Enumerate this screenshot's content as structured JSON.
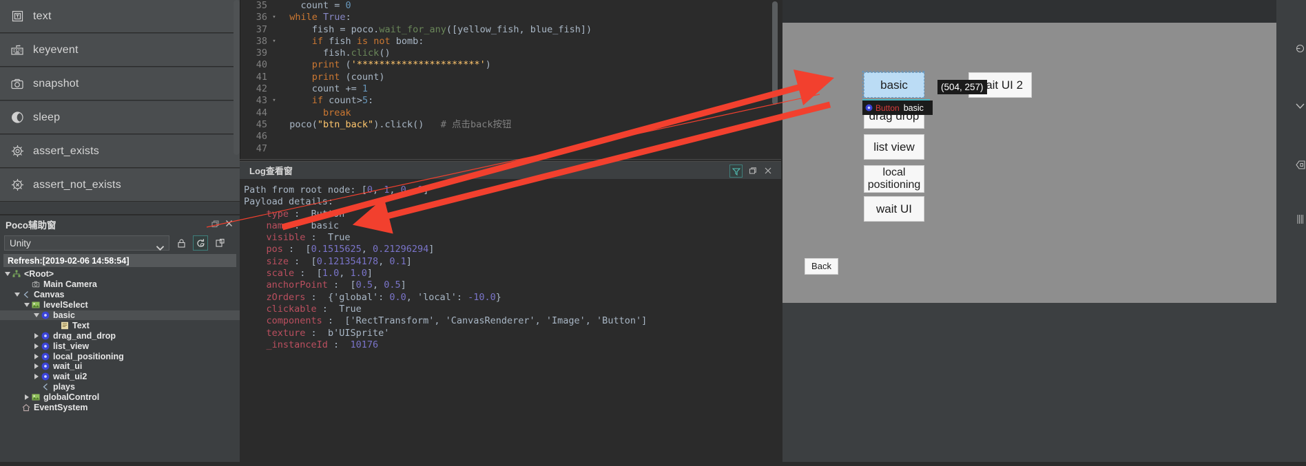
{
  "actions": {
    "items": [
      {
        "label": "text",
        "icon": "text-icon"
      },
      {
        "label": "keyevent",
        "icon": "keyboard-icon"
      },
      {
        "label": "snapshot",
        "icon": "camera-icon"
      },
      {
        "label": "sleep",
        "icon": "moon-icon"
      },
      {
        "label": "assert_exists",
        "icon": "target-icon"
      },
      {
        "label": "assert_not_exists",
        "icon": "target-cross-icon"
      }
    ]
  },
  "editor": {
    "lines": [
      {
        "no": "35",
        "fold": "",
        "tokens": [
          {
            "t": "    ",
            "c": "code"
          },
          {
            "t": "count",
            "c": "code"
          },
          {
            "t": " = ",
            "c": "code"
          },
          {
            "t": "0",
            "c": "num"
          }
        ]
      },
      {
        "no": "36",
        "fold": "▾",
        "tokens": [
          {
            "t": "  ",
            "c": "code"
          },
          {
            "t": "while",
            "c": "kw"
          },
          {
            "t": " ",
            "c": "code"
          },
          {
            "t": "True",
            "c": "bi"
          },
          {
            "t": ":",
            "c": "code"
          }
        ]
      },
      {
        "no": "37",
        "fold": "",
        "tokens": [
          {
            "t": "      fish = poco.",
            "c": "code"
          },
          {
            "t": "wait_for_any",
            "c": "str"
          },
          {
            "t": "([yellow_fish, blue_fish])",
            "c": "code"
          }
        ]
      },
      {
        "no": "38",
        "fold": "▾",
        "tokens": [
          {
            "t": "      ",
            "c": "code"
          },
          {
            "t": "if",
            "c": "kw"
          },
          {
            "t": " fish ",
            "c": "code"
          },
          {
            "t": "is",
            "c": "kw"
          },
          {
            "t": " ",
            "c": "code"
          },
          {
            "t": "not",
            "c": "kw"
          },
          {
            "t": " bomb:",
            "c": "code"
          }
        ]
      },
      {
        "no": "39",
        "fold": "",
        "tokens": [
          {
            "t": "        fish.",
            "c": "code"
          },
          {
            "t": "click",
            "c": "str"
          },
          {
            "t": "()",
            "c": "code"
          }
        ]
      },
      {
        "no": "40",
        "fold": "",
        "tokens": [
          {
            "t": "      ",
            "c": "code"
          },
          {
            "t": "print",
            "c": "kw"
          },
          {
            "t": " (",
            "c": "code"
          },
          {
            "t": "'**********************'",
            "c": "fn"
          },
          {
            "t": ")",
            "c": "code"
          }
        ]
      },
      {
        "no": "41",
        "fold": "",
        "tokens": [
          {
            "t": "      ",
            "c": "code"
          },
          {
            "t": "print",
            "c": "kw"
          },
          {
            "t": " (count)",
            "c": "code"
          }
        ]
      },
      {
        "no": "42",
        "fold": "",
        "tokens": [
          {
            "t": "      count += ",
            "c": "code"
          },
          {
            "t": "1",
            "c": "num"
          }
        ]
      },
      {
        "no": "43",
        "fold": "▾",
        "tokens": [
          {
            "t": "      ",
            "c": "code"
          },
          {
            "t": "if",
            "c": "kw"
          },
          {
            "t": " count>",
            "c": "code"
          },
          {
            "t": "5",
            "c": "num"
          },
          {
            "t": ":",
            "c": "code"
          }
        ]
      },
      {
        "no": "44",
        "fold": "",
        "tokens": [
          {
            "t": "        ",
            "c": "code"
          },
          {
            "t": "break",
            "c": "kw"
          }
        ]
      },
      {
        "no": "45",
        "fold": "",
        "tokens": [
          {
            "t": "  poco(",
            "c": "code"
          },
          {
            "t": "\"btn_back\"",
            "c": "fn"
          },
          {
            "t": ").",
            "c": "code"
          },
          {
            "t": "click",
            "c": "code"
          },
          {
            "t": "()   ",
            "c": "code"
          },
          {
            "t": "# 点击back按钮",
            "c": "cmt"
          }
        ]
      },
      {
        "no": "46",
        "fold": "",
        "tokens": []
      },
      {
        "no": "47",
        "fold": "",
        "tokens": []
      }
    ]
  },
  "log": {
    "title": "Log查看窗",
    "filter_icon": "filter-icon",
    "restore_icon": "restore-icon",
    "close_icon": "close-icon",
    "lines": [
      [
        {
          "t": "Path from root node: ",
          "c": "lval"
        },
        {
          "t": "[",
          "c": "lpunct"
        },
        {
          "t": "0",
          "c": "lnum"
        },
        {
          "t": ", ",
          "c": "lpunct"
        },
        {
          "t": "1",
          "c": "lnum"
        },
        {
          "t": ", ",
          "c": "lpunct"
        },
        {
          "t": "0",
          "c": "lnum"
        },
        {
          "t": ", ",
          "c": "lpunct"
        },
        {
          "t": "0",
          "c": "lnum"
        },
        {
          "t": "]",
          "c": "lpunct"
        }
      ],
      [
        {
          "t": "Payload details:",
          "c": "lval"
        }
      ],
      [
        {
          "t": "    ",
          "c": "lval"
        },
        {
          "t": "type",
          "c": "lkey"
        },
        {
          "t": " :  ",
          "c": "lval"
        },
        {
          "t": "Button",
          "c": "lval"
        }
      ],
      [
        {
          "t": "    ",
          "c": "lval"
        },
        {
          "t": "name",
          "c": "lkey"
        },
        {
          "t": " :  ",
          "c": "lval"
        },
        {
          "t": "basic",
          "c": "lval"
        }
      ],
      [
        {
          "t": "    ",
          "c": "lval"
        },
        {
          "t": "visible",
          "c": "lkey"
        },
        {
          "t": " :  ",
          "c": "lval"
        },
        {
          "t": "True",
          "c": "lval"
        }
      ],
      [
        {
          "t": "    ",
          "c": "lval"
        },
        {
          "t": "pos",
          "c": "lkey"
        },
        {
          "t": " :  ",
          "c": "lval"
        },
        {
          "t": "[",
          "c": "lpunct"
        },
        {
          "t": "0.1515625",
          "c": "lnum"
        },
        {
          "t": ", ",
          "c": "lpunct"
        },
        {
          "t": "0.21296294",
          "c": "lnum"
        },
        {
          "t": "]",
          "c": "lpunct"
        }
      ],
      [
        {
          "t": "    ",
          "c": "lval"
        },
        {
          "t": "size",
          "c": "lkey"
        },
        {
          "t": " :  ",
          "c": "lval"
        },
        {
          "t": "[",
          "c": "lpunct"
        },
        {
          "t": "0.121354178",
          "c": "lnum"
        },
        {
          "t": ", ",
          "c": "lpunct"
        },
        {
          "t": "0.1",
          "c": "lnum"
        },
        {
          "t": "]",
          "c": "lpunct"
        }
      ],
      [
        {
          "t": "    ",
          "c": "lval"
        },
        {
          "t": "scale",
          "c": "lkey"
        },
        {
          "t": " :  ",
          "c": "lval"
        },
        {
          "t": "[",
          "c": "lpunct"
        },
        {
          "t": "1.0",
          "c": "lnum"
        },
        {
          "t": ", ",
          "c": "lpunct"
        },
        {
          "t": "1.0",
          "c": "lnum"
        },
        {
          "t": "]",
          "c": "lpunct"
        }
      ],
      [
        {
          "t": "    ",
          "c": "lval"
        },
        {
          "t": "anchorPoint",
          "c": "lkey"
        },
        {
          "t": " :  ",
          "c": "lval"
        },
        {
          "t": "[",
          "c": "lpunct"
        },
        {
          "t": "0.5",
          "c": "lnum"
        },
        {
          "t": ", ",
          "c": "lpunct"
        },
        {
          "t": "0.5",
          "c": "lnum"
        },
        {
          "t": "]",
          "c": "lpunct"
        }
      ],
      [
        {
          "t": "    ",
          "c": "lval"
        },
        {
          "t": "zOrders",
          "c": "lkey"
        },
        {
          "t": " :  ",
          "c": "lval"
        },
        {
          "t": "{'global': ",
          "c": "lpunct"
        },
        {
          "t": "0.0",
          "c": "lnum"
        },
        {
          "t": ", 'local': ",
          "c": "lpunct"
        },
        {
          "t": "-10.0",
          "c": "lnum"
        },
        {
          "t": "}",
          "c": "lpunct"
        }
      ],
      [
        {
          "t": "    ",
          "c": "lval"
        },
        {
          "t": "clickable",
          "c": "lkey"
        },
        {
          "t": " :  ",
          "c": "lval"
        },
        {
          "t": "True",
          "c": "lval"
        }
      ],
      [
        {
          "t": "    ",
          "c": "lval"
        },
        {
          "t": "components",
          "c": "lkey"
        },
        {
          "t": " :  ",
          "c": "lval"
        },
        {
          "t": "['RectTransform', 'CanvasRenderer', 'Image', 'Button']",
          "c": "lval"
        }
      ],
      [
        {
          "t": "    ",
          "c": "lval"
        },
        {
          "t": "texture",
          "c": "lkey"
        },
        {
          "t": " :  ",
          "c": "lval"
        },
        {
          "t": "b'UISprite'",
          "c": "lval"
        }
      ],
      [
        {
          "t": "    ",
          "c": "lval"
        },
        {
          "t": "_instanceId",
          "c": "lkey"
        },
        {
          "t": " :  ",
          "c": "lval"
        },
        {
          "t": "10176",
          "c": "lnum"
        }
      ]
    ]
  },
  "poco": {
    "title": "Poco辅助窗",
    "restore_icon": "restore-icon",
    "close_icon": "close-icon",
    "engine": "Unity",
    "dropdown_icon": "chevron-down-icon",
    "tools": [
      {
        "name": "lock-icon",
        "active": false
      },
      {
        "name": "refresh-icon",
        "active": true
      },
      {
        "name": "screenshot-icon",
        "active": false
      }
    ],
    "refresh_label": "Refresh:[2019-02-06 14:58:54]",
    "tree": [
      {
        "label": "<Root>",
        "depth": 0,
        "tri": "down",
        "icon": "root-icon",
        "selected": false
      },
      {
        "label": "Main Camera",
        "depth": 2,
        "tri": "none",
        "icon": "camera-icon",
        "selected": false
      },
      {
        "label": "Canvas",
        "depth": 1,
        "tri": "down",
        "icon": "canvas-icon",
        "selected": false
      },
      {
        "label": "levelSelect",
        "depth": 2,
        "tri": "down",
        "icon": "image-icon",
        "selected": false
      },
      {
        "label": "basic",
        "depth": 3,
        "tri": "down",
        "icon": "node-icon",
        "selected": true
      },
      {
        "label": "Text",
        "depth": 5,
        "tri": "none",
        "icon": "text-node-icon",
        "selected": false
      },
      {
        "label": "drag_and_drop",
        "depth": 3,
        "tri": "right",
        "icon": "node-icon",
        "selected": false
      },
      {
        "label": "list_view",
        "depth": 3,
        "tri": "right",
        "icon": "node-icon",
        "selected": false
      },
      {
        "label": "local_positioning",
        "depth": 3,
        "tri": "right",
        "icon": "node-icon",
        "selected": false
      },
      {
        "label": "wait_ui",
        "depth": 3,
        "tri": "right",
        "icon": "node-icon",
        "selected": false
      },
      {
        "label": "wait_ui2",
        "depth": 3,
        "tri": "right",
        "icon": "node-icon",
        "selected": false
      },
      {
        "label": "plays",
        "depth": 3,
        "tri": "none",
        "icon": "canvas-icon",
        "selected": false
      },
      {
        "label": "globalControl",
        "depth": 2,
        "tri": "right",
        "icon": "image-icon",
        "selected": false
      },
      {
        "label": "EventSystem",
        "depth": 1,
        "tri": "none",
        "icon": "event-icon",
        "selected": false
      }
    ]
  },
  "device": {
    "buttons": {
      "basic": "basic",
      "drag_drop": "drag drop",
      "list_view": "list view",
      "local_positioning_l1": "local",
      "local_positioning_l2": "positioning",
      "wait_ui": "wait UI",
      "wait_ui2": "wait UI 2",
      "back": "Back"
    },
    "coord_tooltip": "(504, 257)",
    "node_tooltip": {
      "type": "Button",
      "name": "basic"
    }
  },
  "rail": {
    "icons": [
      "power-icon",
      "chevron-down-icon",
      "collapse-back-icon",
      "grip-icon"
    ]
  },
  "colors": {
    "accent_teal": "#3f7f7c",
    "annotation_red": "#f2402e",
    "selection_blue": "#bbdcf5",
    "panel_bg": "#3c3f41",
    "editor_bg": "#2b2b2b"
  }
}
